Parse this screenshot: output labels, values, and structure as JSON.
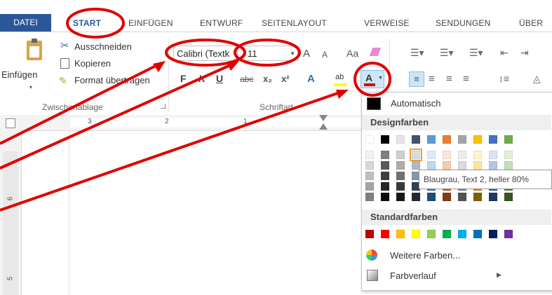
{
  "tabs": [
    "DATEI",
    "START",
    "EINFÜGEN",
    "ENTWURF",
    "SEITENLAYOUT",
    "VERWEISE",
    "SENDUNGEN",
    "ÜBER"
  ],
  "clipboard": {
    "paste_label": "Einfügen",
    "cut_label": "Ausschneiden",
    "copy_label": "Kopieren",
    "format_painter_label": "Format übertragen",
    "group_label": "Zwischenablage"
  },
  "font": {
    "font_name": "Calibri (Textk",
    "font_size": "11",
    "group_label": "Schriftart",
    "grow": "A",
    "shrink": "A",
    "case": "Aa",
    "bold": "F",
    "italic": "K",
    "underline": "U",
    "strike": "abc",
    "subscript": "x₂",
    "superscript": "x²",
    "text_effects": "A",
    "highlight": "ab",
    "font_color": "A"
  },
  "ruler": {
    "h_numbers": [
      "3",
      "2",
      "1"
    ],
    "v_numbers": [
      "6",
      "5"
    ]
  },
  "color_menu": {
    "automatic_label": "Automatisch",
    "design_colors_label": "Designfarben",
    "standard_colors_label": "Standardfarben",
    "more_colors_label": "Weitere Farben...",
    "gradient_label": "Farbverlauf",
    "tooltip": "Blaugrau, Text 2, heller 80%",
    "theme_top": [
      "#ffffff",
      "#000000",
      "#e7e6e6",
      "#44546a",
      "#5b9bd5",
      "#ed7d31",
      "#a5a5a5",
      "#ffc000",
      "#4472c4",
      "#70ad47"
    ],
    "theme_shades": [
      [
        "#f2f2f2",
        "#7f7f7f",
        "#d0cece",
        "#d6dce4",
        "#deebf6",
        "#fbe5d5",
        "#ededed",
        "#fff2cc",
        "#dae3f3",
        "#e2efd9"
      ],
      [
        "#d8d8d8",
        "#595959",
        "#aeabab",
        "#adb9ca",
        "#bdd7ee",
        "#f7cbac",
        "#dbdbdb",
        "#fee599",
        "#b4c6e7",
        "#c5e0b3"
      ],
      [
        "#bfbfbf",
        "#3f3f3f",
        "#757070",
        "#8496b0",
        "#9cc3e5",
        "#f4b183",
        "#c9c9c9",
        "#ffd965",
        "#8eaadb",
        "#a8d08d"
      ],
      [
        "#a5a5a5",
        "#262626",
        "#3a3838",
        "#323f4f",
        "#2e75b5",
        "#c55a11",
        "#7b7b7b",
        "#bf9000",
        "#2f5496",
        "#538135"
      ],
      [
        "#7f7f7f",
        "#0c0c0c",
        "#171616",
        "#222a35",
        "#1e4e79",
        "#833c0b",
        "#525252",
        "#7f6000",
        "#1f3864",
        "#375623"
      ]
    ],
    "standard": [
      "#c00000",
      "#ff0000",
      "#ffc000",
      "#ffff00",
      "#92d050",
      "#00b050",
      "#00b0f0",
      "#0070c0",
      "#002060",
      "#7030a0"
    ]
  },
  "annotation_color": "#e00000"
}
